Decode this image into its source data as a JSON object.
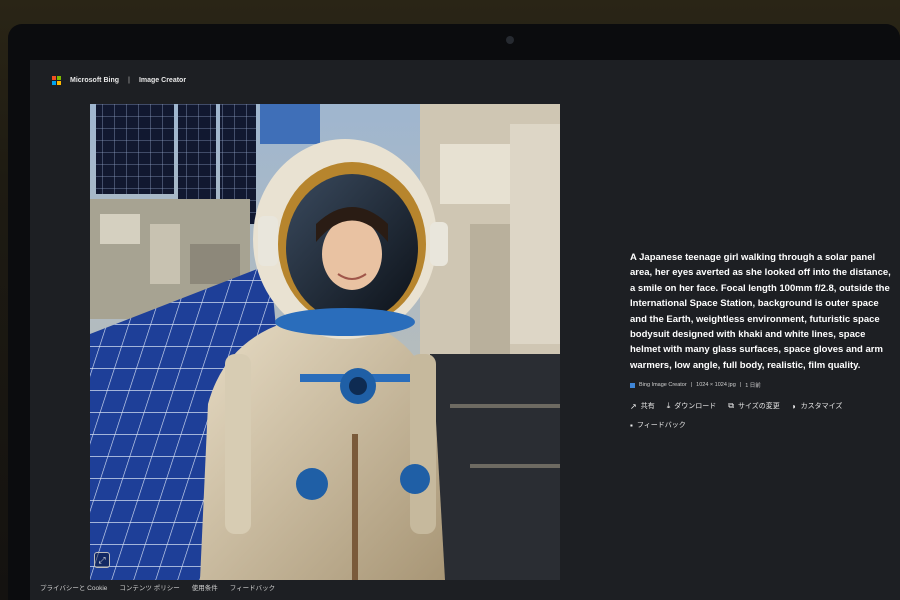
{
  "header": {
    "brand": "Microsoft Bing",
    "separator": "|",
    "app_title": "Image Creator"
  },
  "image": {
    "alt": "Generated image: Japanese teenage girl in a khaki and white space suit at a solar panel area",
    "icon": "expand-icon"
  },
  "info": {
    "description": "A Japanese teenage girl walking through a solar panel area, her eyes averted as she looked off into the distance, a smile on her face. Focal length 100mm f/2.8, outside the International Space Station, background is outer space and the Earth, weightless environment, futuristic space bodysuit designed with khaki and white lines, space helmet with many glass surfaces, space gloves and arm warmers, low angle, full body, realistic, film quality.",
    "meta_source": "Bing Image Creator",
    "meta_sep": "|",
    "meta_size": "1024 × 1024 jpg",
    "meta_time": "1 日前"
  },
  "actions": {
    "share": "共有",
    "download": "ダウンロード",
    "resize": "サイズの変更",
    "customize": "カスタマイズ",
    "feedback": "フィードバック"
  },
  "footer": {
    "privacy": "プライバシーと Cookie",
    "content_policy": "コンテンツ ポリシー",
    "terms": "使用条件",
    "feedback": "フィードバック"
  },
  "colors": {
    "screen_bg": "#1d1f23",
    "ms_red": "#f25022",
    "ms_green": "#7fba00",
    "ms_blue": "#00a4ef",
    "ms_yellow": "#ffb900",
    "panel_blue": "#1b3b8a"
  }
}
